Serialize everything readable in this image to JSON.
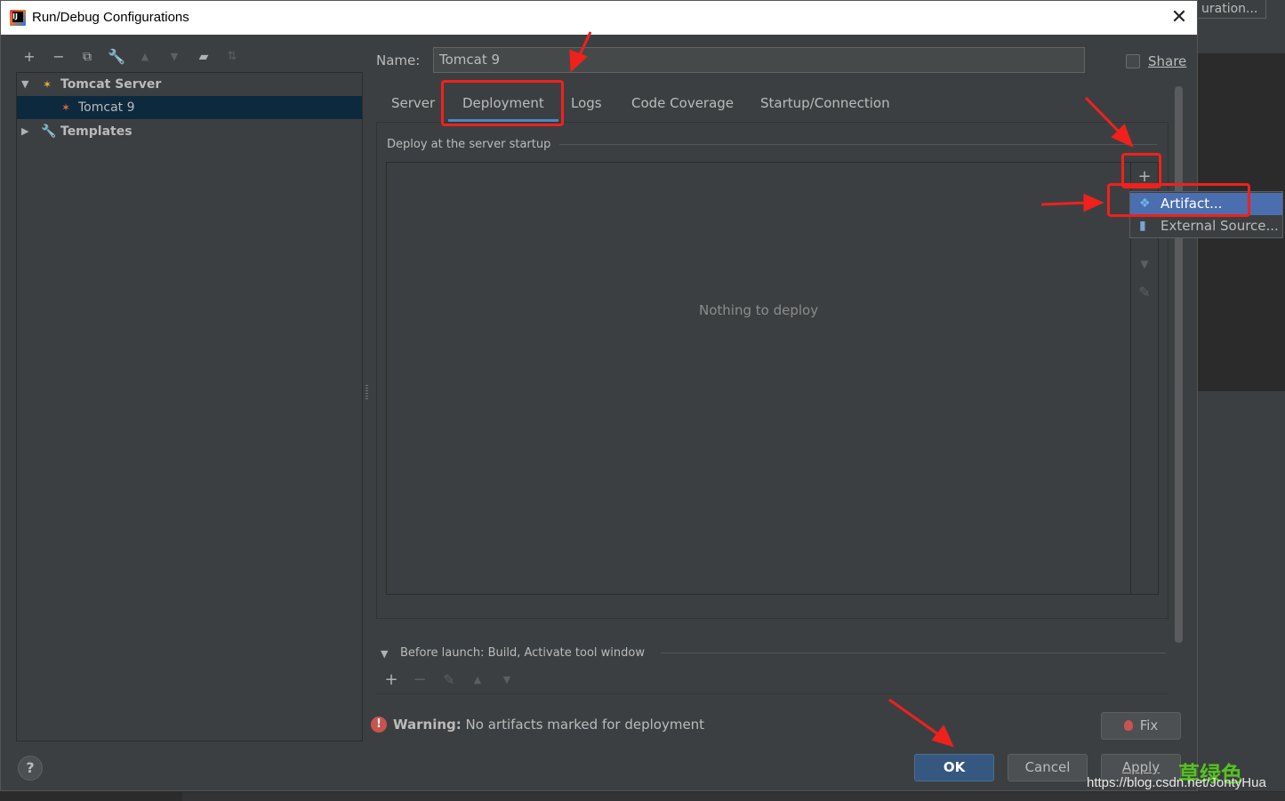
{
  "background": {
    "configuration_button_label": "uration..."
  },
  "window": {
    "title": "Run/Debug Configurations",
    "close_label": "✕"
  },
  "tree": {
    "items": [
      {
        "label": "Tomcat Server"
      },
      {
        "label": "Tomcat 9"
      },
      {
        "label": "Templates"
      }
    ]
  },
  "form": {
    "name_label": "Name:",
    "name_value": "Tomcat 9",
    "share_label": "Share"
  },
  "tabs": [
    {
      "label": "Server"
    },
    {
      "label": "Deployment"
    },
    {
      "label": "Logs"
    },
    {
      "label": "Code Coverage"
    },
    {
      "label": "Startup/Connection"
    }
  ],
  "deployment": {
    "group_title": "Deploy at the server startup",
    "empty_text": "Nothing to deploy",
    "add_symbol": "+"
  },
  "popup": {
    "items": [
      {
        "label": "Artifact..."
      },
      {
        "label": "External Source..."
      }
    ]
  },
  "before_launch": {
    "title": "Before launch: Build, Activate tool window"
  },
  "warning": {
    "prefix": "Warning:",
    "message": "No artifacts marked for deployment",
    "fix_label": "Fix"
  },
  "buttons": {
    "ok": "OK",
    "cancel": "Cancel",
    "apply": "Apply",
    "help": "?"
  },
  "watermark": {
    "chinese": "草绿色",
    "url": "https://blog.csdn.net/JontyHua"
  },
  "colors": {
    "accent": "#4a88c7",
    "selection": "#0d293e",
    "annotation_red": "#f0211c",
    "popup_highlight": "#4b6eaf"
  }
}
